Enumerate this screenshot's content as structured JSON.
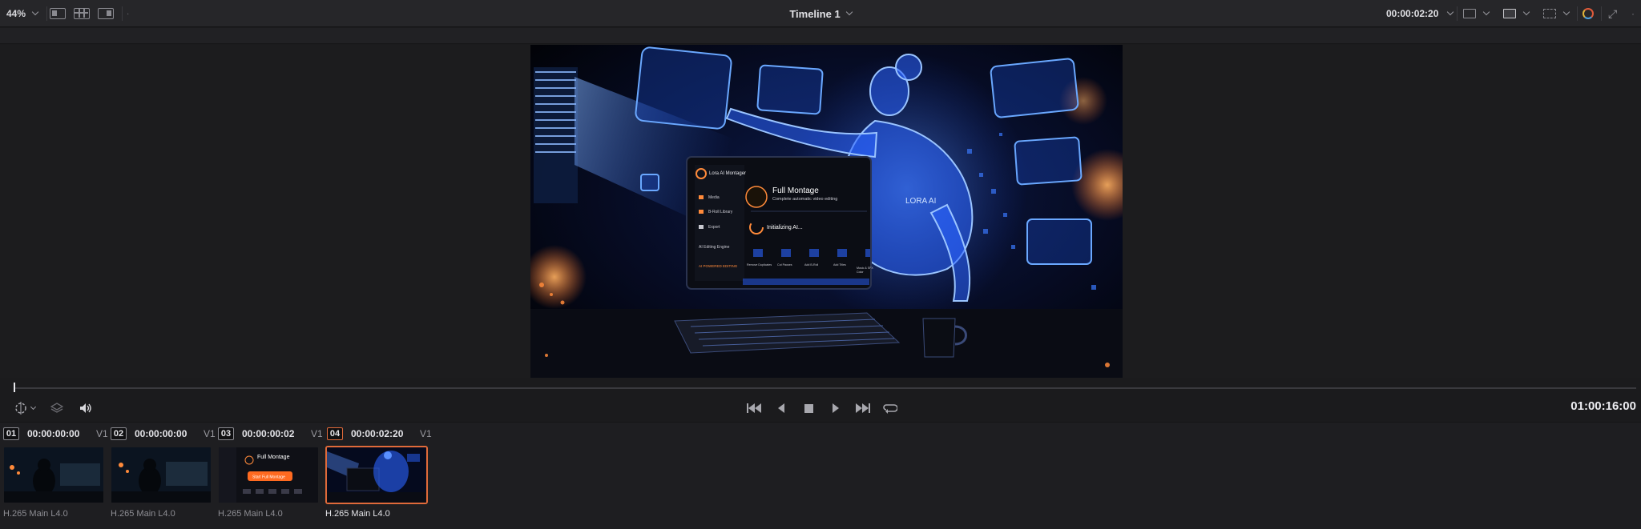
{
  "toolbar": {
    "zoom": "44%",
    "timeline_title": "Timeline 1",
    "timecode": "00:00:02:20"
  },
  "viewer": {
    "frame_screen": {
      "app_name": "Lora AI Montager",
      "heading": "Full Montage",
      "subheading": "Complete automatic video editing",
      "status": "Initializing AI...",
      "sidebar": [
        "Media",
        "B-Roll Library",
        "Export"
      ],
      "engine": "AI Editing Engine",
      "powered": "AI POWERED EDITING",
      "body_label": "LORA AI",
      "tools": [
        "Remove Duplicates",
        "Cut Pauses",
        "Add B-Roll",
        "Add Titles",
        "Music & SFX",
        "Color"
      ]
    }
  },
  "transport": {
    "timecode": "01:00:16:00"
  },
  "clips": [
    {
      "num": "01",
      "timecode": "00:00:00:00",
      "track": "V1",
      "codec": "H.265 Main L4.0",
      "active": false
    },
    {
      "num": "02",
      "timecode": "00:00:00:00",
      "track": "V1",
      "codec": "H.265 Main L4.0",
      "active": false
    },
    {
      "num": "03",
      "timecode": "00:00:00:02",
      "track": "V1",
      "codec": "H.265 Main L4.0",
      "active": false,
      "thumb_heading": "Full Montage",
      "thumb_button": "Start Full Montage"
    },
    {
      "num": "04",
      "timecode": "00:00:02:20",
      "track": "V1",
      "codec": "H.265 Main L4.0",
      "active": true
    }
  ],
  "colors": {
    "accent": "#e06a3a",
    "glow": "#2a6cff"
  }
}
